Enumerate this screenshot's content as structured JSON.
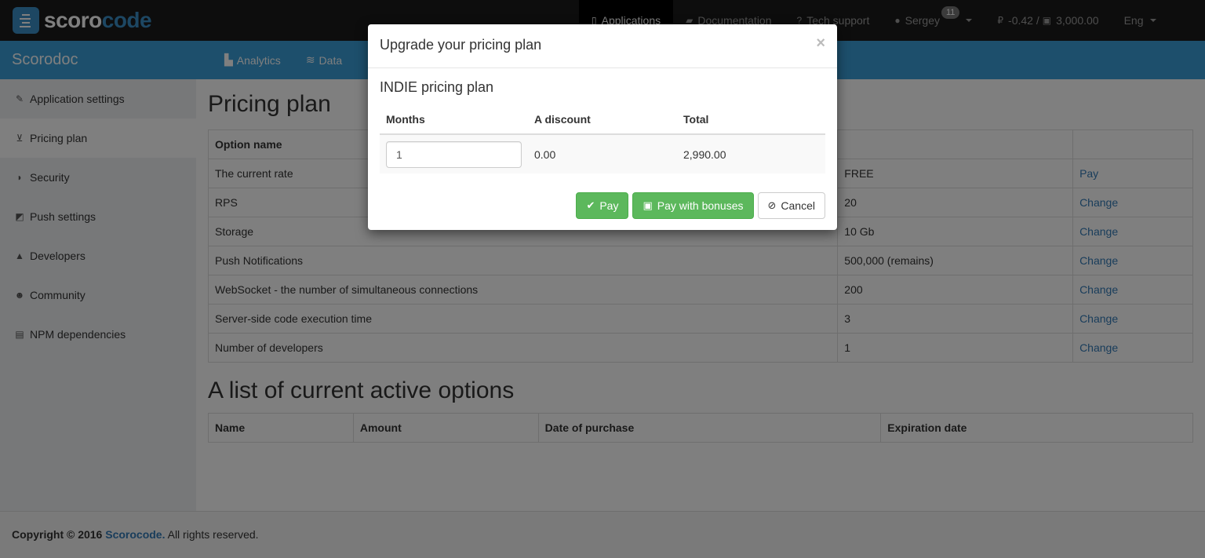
{
  "topbar": {
    "logo_text_a": "scoro",
    "logo_text_b": "code",
    "nav": [
      {
        "label": "Applications",
        "icon": "mobile-icon"
      },
      {
        "label": "Documentation",
        "icon": "book-icon"
      },
      {
        "label": "Tech support",
        "icon": "question-icon"
      }
    ],
    "user": {
      "name": "Sergey",
      "badge": "11"
    },
    "balance": "-0.42 / ",
    "bonus": "3,000.00",
    "language": "Eng"
  },
  "appbar": {
    "app_name": "Scorodoc",
    "nav": [
      {
        "label": "Analytics",
        "icon": "chart-icon"
      },
      {
        "label": "Data",
        "icon": "database-icon"
      }
    ]
  },
  "sidebar": {
    "items": [
      {
        "label": "Application settings",
        "icon": "wrench-icon"
      },
      {
        "label": "Pricing plan",
        "icon": "cart-icon"
      },
      {
        "label": "Security",
        "icon": "shield-icon"
      },
      {
        "label": "Push settings",
        "icon": "push-icon"
      },
      {
        "label": "Developers",
        "icon": "lock-icon"
      },
      {
        "label": "Community",
        "icon": "users-icon"
      },
      {
        "label": "NPM dependencies",
        "icon": "file-chart-icon"
      }
    ]
  },
  "main": {
    "title": "Pricing plan",
    "options_table": {
      "header": "Option name",
      "rows": [
        {
          "name": "The current rate",
          "value": "FREE",
          "action": "Pay"
        },
        {
          "name": "RPS",
          "value": "20",
          "action": "Change"
        },
        {
          "name": "Storage",
          "value": "10 Gb",
          "action": "Change"
        },
        {
          "name": "Push Notifications",
          "value": "500,000 (remains)",
          "action": "Change"
        },
        {
          "name": "WebSocket - the number of simultaneous connections",
          "value": "200",
          "action": "Change"
        },
        {
          "name": "Server-side code execution time",
          "value": "3",
          "action": "Change"
        },
        {
          "name": "Number of developers",
          "value": "1",
          "action": "Change"
        }
      ]
    },
    "active_title": "A list of current active options",
    "active_table": {
      "headers": [
        "Name",
        "Amount",
        "Date of purchase",
        "Expiration date"
      ]
    }
  },
  "footer": {
    "prefix": "Copyright © 2016",
    "brand": "Scorocode.",
    "suffix": " All rights reserved."
  },
  "modal": {
    "title": "Upgrade your pricing plan",
    "close": "×",
    "plan_title": "INDIE pricing plan",
    "table": {
      "headers": [
        "Months",
        "A discount",
        "Total"
      ],
      "months_value": "1",
      "discount": "0.00",
      "total": "2,990.00"
    },
    "buttons": {
      "pay": "Pay",
      "pay_bonuses": "Pay with bonuses",
      "cancel": "Cancel"
    }
  }
}
